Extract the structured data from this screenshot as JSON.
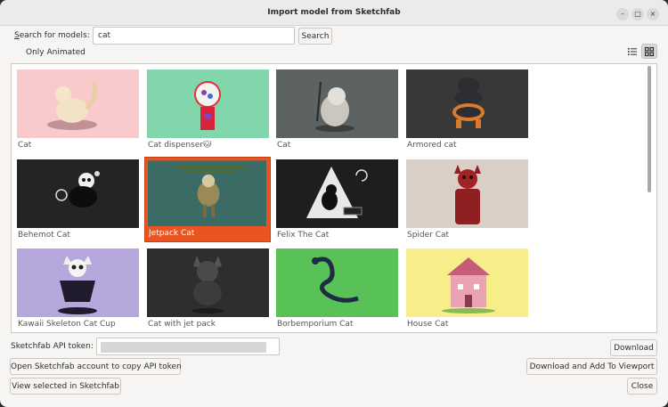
{
  "window": {
    "title": "Import model from Sketchfab"
  },
  "controls": {
    "minimize": "–",
    "maximize": "□",
    "close": "×"
  },
  "search": {
    "label_mnemonic": "S",
    "label_rest": "earch for models:",
    "value": "cat",
    "button": "Search"
  },
  "filter": {
    "only_animated": "Only Animated",
    "only_animated_checked": false
  },
  "view_toggle": {
    "list_icon": "list-view-icon",
    "grid_icon": "grid-view-icon",
    "active": "grid"
  },
  "models": [
    {
      "name": "Cat",
      "selected": false
    },
    {
      "name": "Cat dispenser🐱",
      "selected": false
    },
    {
      "name": "Cat",
      "selected": false
    },
    {
      "name": "Armored cat",
      "selected": false
    },
    {
      "name": "Behemot Cat",
      "selected": false
    },
    {
      "name": "Jetpack Cat",
      "selected": true
    },
    {
      "name": "Felix The Cat",
      "selected": false
    },
    {
      "name": "Spider Cat",
      "selected": false
    },
    {
      "name": "Kawaii Skeleton Cat Cup",
      "selected": false
    },
    {
      "name": "Cat with jet pack",
      "selected": false
    },
    {
      "name": "Borbemporium Cat",
      "selected": false
    },
    {
      "name": "House Cat",
      "selected": false
    }
  ],
  "api": {
    "token_label": "Sketchfab API token:",
    "open_account_button": "Open Sketchfab account to copy API token",
    "view_selected_button": "View selected in Sketchfab"
  },
  "actions": {
    "download": "Download",
    "download_add": "Download and Add To Viewport",
    "close": "Close"
  }
}
